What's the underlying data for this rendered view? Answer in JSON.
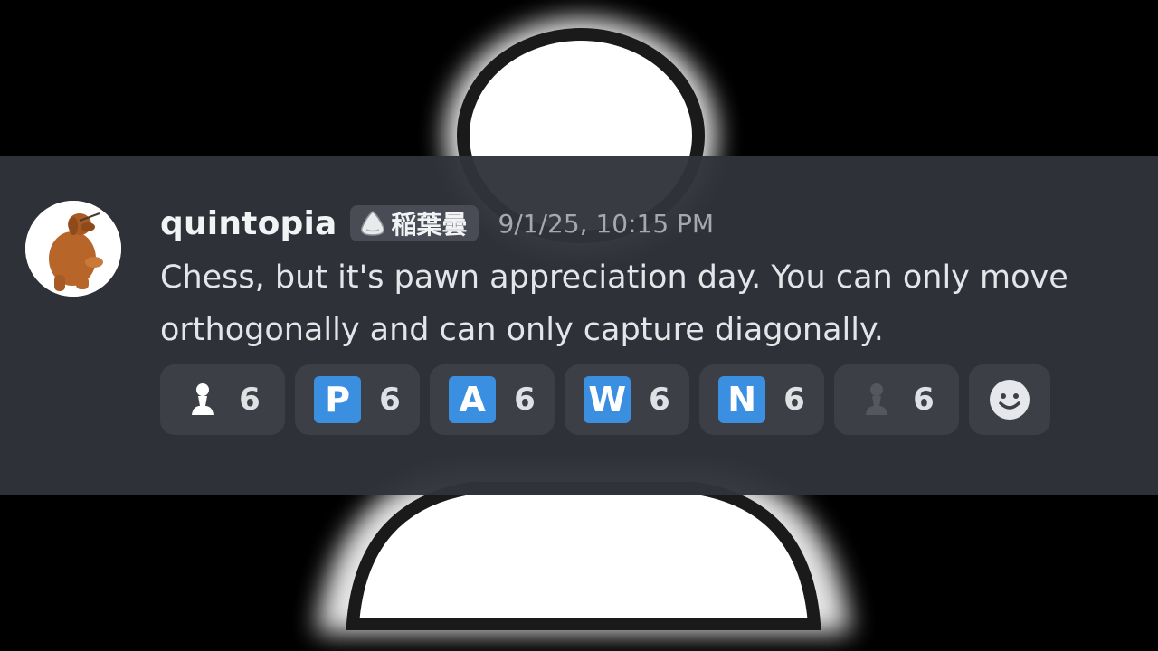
{
  "message": {
    "author": "quintopia",
    "role_tag": "稲葉曇",
    "timestamp": "9/1/25, 10:15 PM",
    "content": "Chess, but it's pawn appreciation day. You can only move orthogonally and can only capture diagonally."
  },
  "reactions": [
    {
      "emoji": "white-pawn",
      "count": "6"
    },
    {
      "emoji": "P",
      "count": "6"
    },
    {
      "emoji": "A",
      "count": "6"
    },
    {
      "emoji": "W",
      "count": "6"
    },
    {
      "emoji": "N",
      "count": "6"
    },
    {
      "emoji": "black-pawn",
      "count": "6"
    }
  ],
  "add_reaction_icon": "smiley-icon",
  "colors": {
    "background": "#000000",
    "message_background": "#31333a",
    "letter_emoji": "#3b8fe0",
    "reaction_pill": "#3d3f47"
  }
}
